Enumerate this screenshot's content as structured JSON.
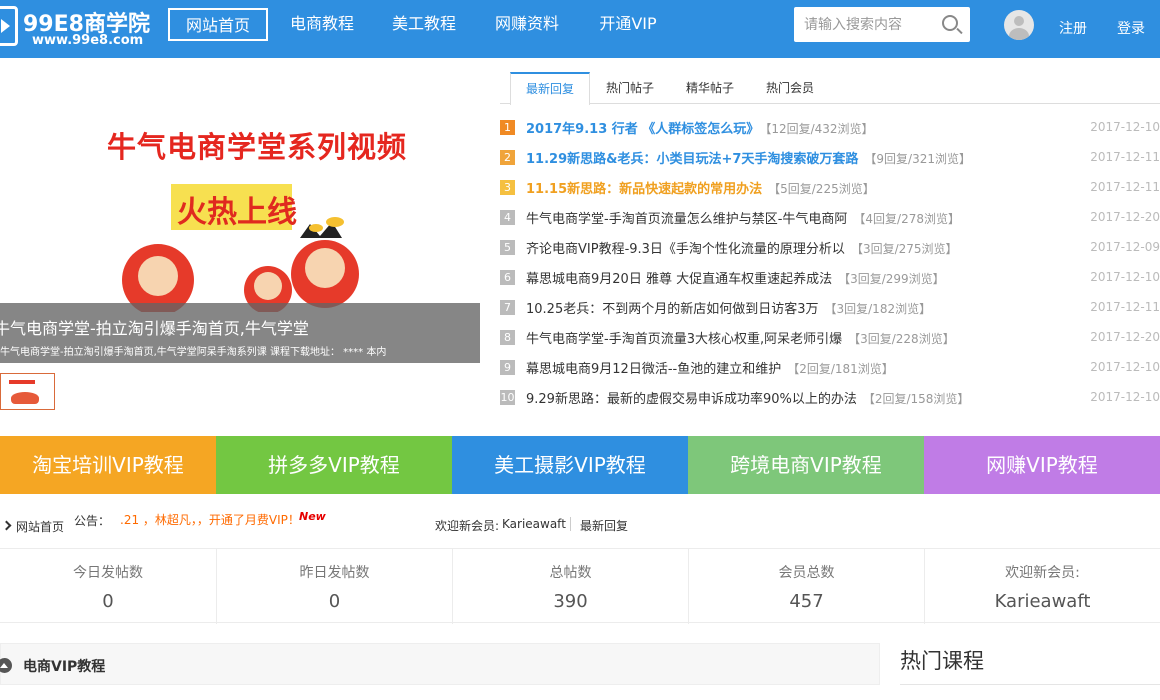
{
  "header": {
    "logo_title": "99E8商学院",
    "logo_url": "www.99e8.com",
    "nav": [
      "网站首页",
      "电商教程",
      "美工教程",
      "网赚资料",
      "开通VIP"
    ],
    "search_placeholder": "请输入搜索内容",
    "register": "注册",
    "login": "登录",
    "accent": "#2f8fe0"
  },
  "slider": {
    "headline": "牛气电商学堂系列视频",
    "badge": "火热上线",
    "caption_title": "牛气电商学堂-拍立淘引爆手淘首页,牛气学堂",
    "caption_desc": "牛气电商学堂-拍立淘引爆手淘首页,牛气学堂阿呆手淘系列课 课程下载地址： **** 本内"
  },
  "tabs": [
    "最新回复",
    "热门帖子",
    "精华帖子",
    "热门会员"
  ],
  "posts": [
    {
      "num": "1",
      "title": "2017年9.13 行者 《人群标签怎么玩》",
      "meta": "【12回复/432浏览】",
      "date": "2017-12-10",
      "color": "#2f8fe0",
      "num_bg": "#f08a24",
      "hot": true
    },
    {
      "num": "2",
      "title": "11.29新思路&老兵：小类目玩法+7天手淘搜索破万套路",
      "meta": "【9回复/321浏览】",
      "date": "2017-12-11",
      "color": "#2f8fe0",
      "num_bg": "#f0a43a",
      "hot": true
    },
    {
      "num": "3",
      "title": "11.15新思路：新品快速起款的常用办法",
      "meta": "【5回复/225浏览】",
      "date": "2017-12-11",
      "color": "#f0a020",
      "num_bg": "#f5c040",
      "hot": true
    },
    {
      "num": "4",
      "title": "牛气电商学堂-手淘首页流量怎么维护与禁区-牛气电商阿",
      "meta": "【4回复/278浏览】",
      "date": "2017-12-20",
      "color": "#333333",
      "num_bg": "#bbbbbb",
      "hot": false
    },
    {
      "num": "5",
      "title": "齐论电商VIP教程-9.3日《手淘个性化流量的原理分析以",
      "meta": "【3回复/275浏览】",
      "date": "2017-12-09",
      "color": "#333333",
      "num_bg": "#bbbbbb",
      "hot": false
    },
    {
      "num": "6",
      "title": "幕思城电商9月20日 雅尊 大促直通车权重速起养成法",
      "meta": "【3回复/299浏览】",
      "date": "2017-12-10",
      "color": "#333333",
      "num_bg": "#bbbbbb",
      "hot": false
    },
    {
      "num": "7",
      "title": "10.25老兵：不到两个月的新店如何做到日访客3万",
      "meta": "【3回复/182浏览】",
      "date": "2017-12-11",
      "color": "#333333",
      "num_bg": "#bbbbbb",
      "hot": false
    },
    {
      "num": "8",
      "title": "牛气电商学堂-手淘首页流量3大核心权重,阿呆老师引爆",
      "meta": "【3回复/228浏览】",
      "date": "2017-12-20",
      "color": "#333333",
      "num_bg": "#bbbbbb",
      "hot": false
    },
    {
      "num": "9",
      "title": "幕思城电商9月12日微活--鱼池的建立和维护",
      "meta": "【2回复/181浏览】",
      "date": "2017-12-10",
      "color": "#333333",
      "num_bg": "#bbbbbb",
      "hot": false
    },
    {
      "num": "10",
      "title": "9.29新思路：最新的虚假交易申诉成功率90%以上的办法",
      "meta": "【2回复/158浏览】",
      "date": "2017-12-10",
      "color": "#333333",
      "num_bg": "#bbbbbb",
      "hot": false
    }
  ],
  "banners": [
    {
      "label": "淘宝培训VIP教程",
      "color": "#f5a623"
    },
    {
      "label": "拼多多VIP教程",
      "color": "#73c742"
    },
    {
      "label": "美工摄影VIP教程",
      "color": "#2f8fe0"
    },
    {
      "label": "跨境电商VIP教程",
      "color": "#7ec77a"
    },
    {
      "label": "网赚VIP教程",
      "color": "#c07ce6"
    }
  ],
  "notice": {
    "home": "网站首页",
    "label": "公告：",
    "text": ".21 ，林超凡，，开通了月费VIP！",
    "new_badge": "New",
    "welcome_label": "欢迎新会员:",
    "welcome_user": "Karieawaft",
    "latest": "最新回复"
  },
  "stats": [
    {
      "label": "今日发帖数",
      "value": "0"
    },
    {
      "label": "昨日发帖数",
      "value": "0"
    },
    {
      "label": "总帖数",
      "value": "390"
    },
    {
      "label": "会员总数",
      "value": "457"
    },
    {
      "label": "欢迎新会员:",
      "value": "Karieawaft"
    }
  ],
  "section": {
    "title": "电商VIP教程",
    "hot_title": "热门课程"
  }
}
